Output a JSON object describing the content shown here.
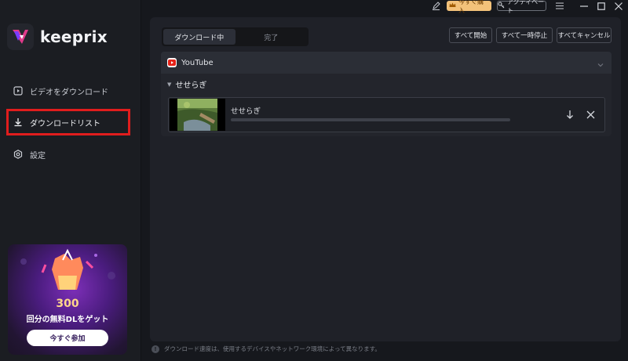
{
  "app": {
    "name": "keeprix"
  },
  "sidebar": {
    "items": [
      {
        "label": "ビデオをダウンロード",
        "icon": "play-square-icon"
      },
      {
        "label": "ダウンロードリスト",
        "icon": "download-icon",
        "active": true
      },
      {
        "label": "設定",
        "icon": "settings-icon"
      }
    ]
  },
  "promo": {
    "number": "300",
    "text": "回分の無料DLをゲット",
    "button": "今すぐ参加"
  },
  "titlebar": {
    "buy_label": "今すぐ購入",
    "activate_label": "アクティベート"
  },
  "tabs": [
    {
      "label": "ダウンロード中",
      "active": true
    },
    {
      "label": "完了",
      "active": false
    }
  ],
  "actions": {
    "start_all": "すべて開始",
    "pause_all": "すべて一時停止",
    "cancel_all": "すべてキャンセル"
  },
  "platform": {
    "name": "YouTube",
    "group_title": "せせらぎ",
    "items": [
      {
        "title": "せせらぎ",
        "progress": 0
      }
    ]
  },
  "footer": {
    "note": "ダウンロード速度は、使用するデバイスやネットワーク環境によって異なります。"
  },
  "colors": {
    "accent_red": "#e01d1d",
    "buy_bg": "#f3c27a",
    "promo_number": "#ffd78a"
  }
}
